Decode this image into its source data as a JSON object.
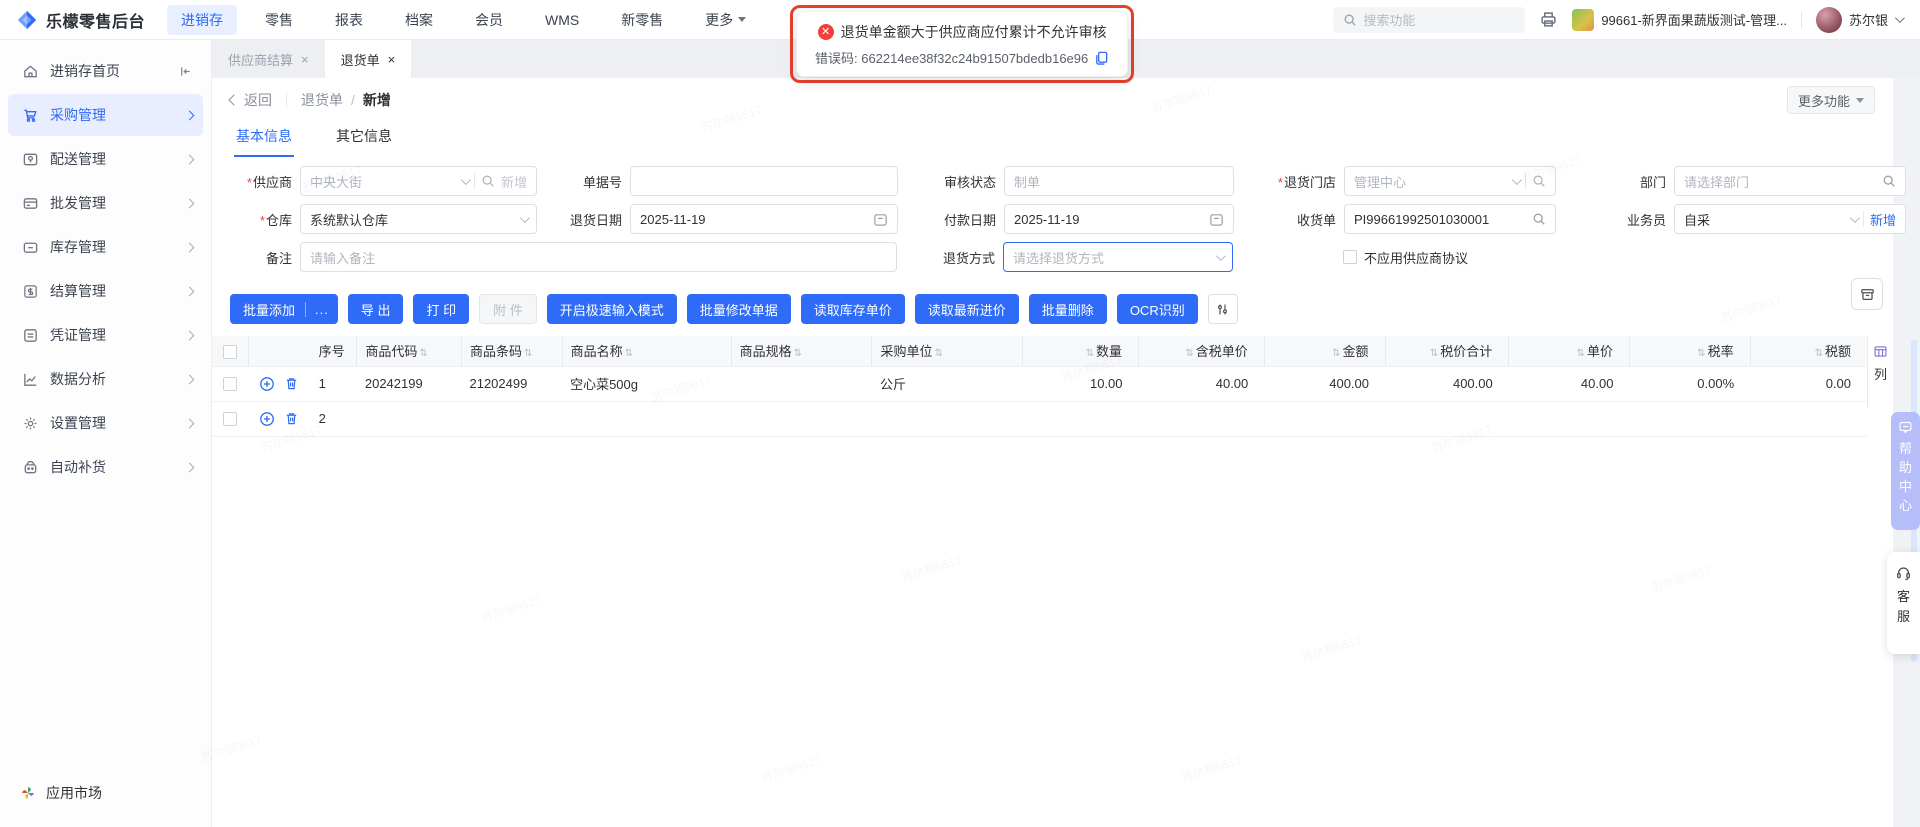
{
  "colors": {
    "accent": "#2e6bf6",
    "danger": "#e8402d",
    "help_tab_bg": "#b5bef8"
  },
  "watermark": "苏尔银9617",
  "topbar": {
    "logo_text": "乐檬零售后台",
    "nav": {
      "n0": "进销存",
      "n1": "零售",
      "n2": "报表",
      "n3": "档案",
      "n4": "会员",
      "n5": "WMS",
      "n6": "新零售",
      "n7": "更多"
    },
    "search_placeholder": "搜索功能",
    "tenant_name": "99661-新界面果蔬版测试-管理...",
    "user_name": "苏尔银"
  },
  "toast": {
    "message": "退货单金额大于供应商应付累计不允许审核",
    "code_line": "错误码: 662214ee38f32c24b91507bdedb16e96"
  },
  "sidebar": {
    "items": {
      "i0": "进销存首页",
      "i1": "采购管理",
      "i2": "配送管理",
      "i3": "批发管理",
      "i4": "库存管理",
      "i5": "结算管理",
      "i6": "凭证管理",
      "i7": "数据分析",
      "i8": "设置管理",
      "i9": "自动补货"
    },
    "app_market": "应用市场"
  },
  "tabs": {
    "tab1": "供应商结算",
    "tab2": "退货单"
  },
  "breadcrumb": {
    "back": "返回",
    "parent": "退货单",
    "sep": "/",
    "current": "新增",
    "more_btn": "更多功能"
  },
  "form_tabs": {
    "basic": "基本信息",
    "other": "其它信息"
  },
  "form": {
    "supplier_label": "供应商",
    "supplier_value": "中央大街",
    "supplier_action": "新增",
    "docno_label": "单据号",
    "audit_label": "审核状态",
    "audit_value": "制单",
    "store_label": "退货门店",
    "store_value": "管理中心",
    "dept_label": "部门",
    "dept_placeholder": "请选择部门",
    "warehouse_label": "仓库",
    "warehouse_value": "系统默认仓库",
    "return_date_label": "退货日期",
    "return_date_value": "2025-11-19",
    "pay_date_label": "付款日期",
    "pay_date_value": "2025-11-19",
    "receipt_label": "收货单",
    "receipt_value": "PI99661992501030001",
    "salesman_label": "业务员",
    "salesman_value": "自采",
    "salesman_action": "新增",
    "remark_label": "备注",
    "remark_placeholder": "请输入备注",
    "method_label": "退货方式",
    "method_placeholder": "请选择退货方式",
    "checkbox_label": "不应用供应商协议"
  },
  "toolbar": {
    "b1": "批量添加",
    "b1_more": "...",
    "b2": "导 出",
    "b3": "打 印",
    "b4": "附 件",
    "b5": "开启极速输入模式",
    "b6": "批量修改单据",
    "b7": "读取库存单价",
    "b8": "读取最新进价",
    "b9": "批量删除",
    "b10": "OCR识别"
  },
  "table": {
    "headers": {
      "seq": "序号",
      "code": "商品代码",
      "barcode": "商品条码",
      "name": "商品名称",
      "spec": "商品规格",
      "unit": "采购单位",
      "qty": "数量",
      "tax_price": "含税单价",
      "amount": "金额",
      "tax_total": "税价合计",
      "price": "单价",
      "tax_rate": "税率",
      "tax_amount": "税额"
    },
    "rows": [
      {
        "seq": "1",
        "code": "20242199",
        "barcode": "21202499",
        "name": "空心菜500g",
        "spec": "",
        "unit": "公斤",
        "qty": "10.00",
        "tax_price": "40.00",
        "amount": "400.00",
        "tax_total": "400.00",
        "price": "40.00",
        "tax_rate": "0.00%",
        "tax_amount": "0.00"
      },
      {
        "seq": "2",
        "code": "",
        "barcode": "",
        "name": "",
        "spec": "",
        "unit": "",
        "qty": "",
        "tax_price": "",
        "amount": "",
        "tax_total": "",
        "price": "",
        "tax_rate": "",
        "tax_amount": ""
      }
    ],
    "column_panel": "列"
  },
  "floats": {
    "help": "帮助中心",
    "service": "客服"
  }
}
